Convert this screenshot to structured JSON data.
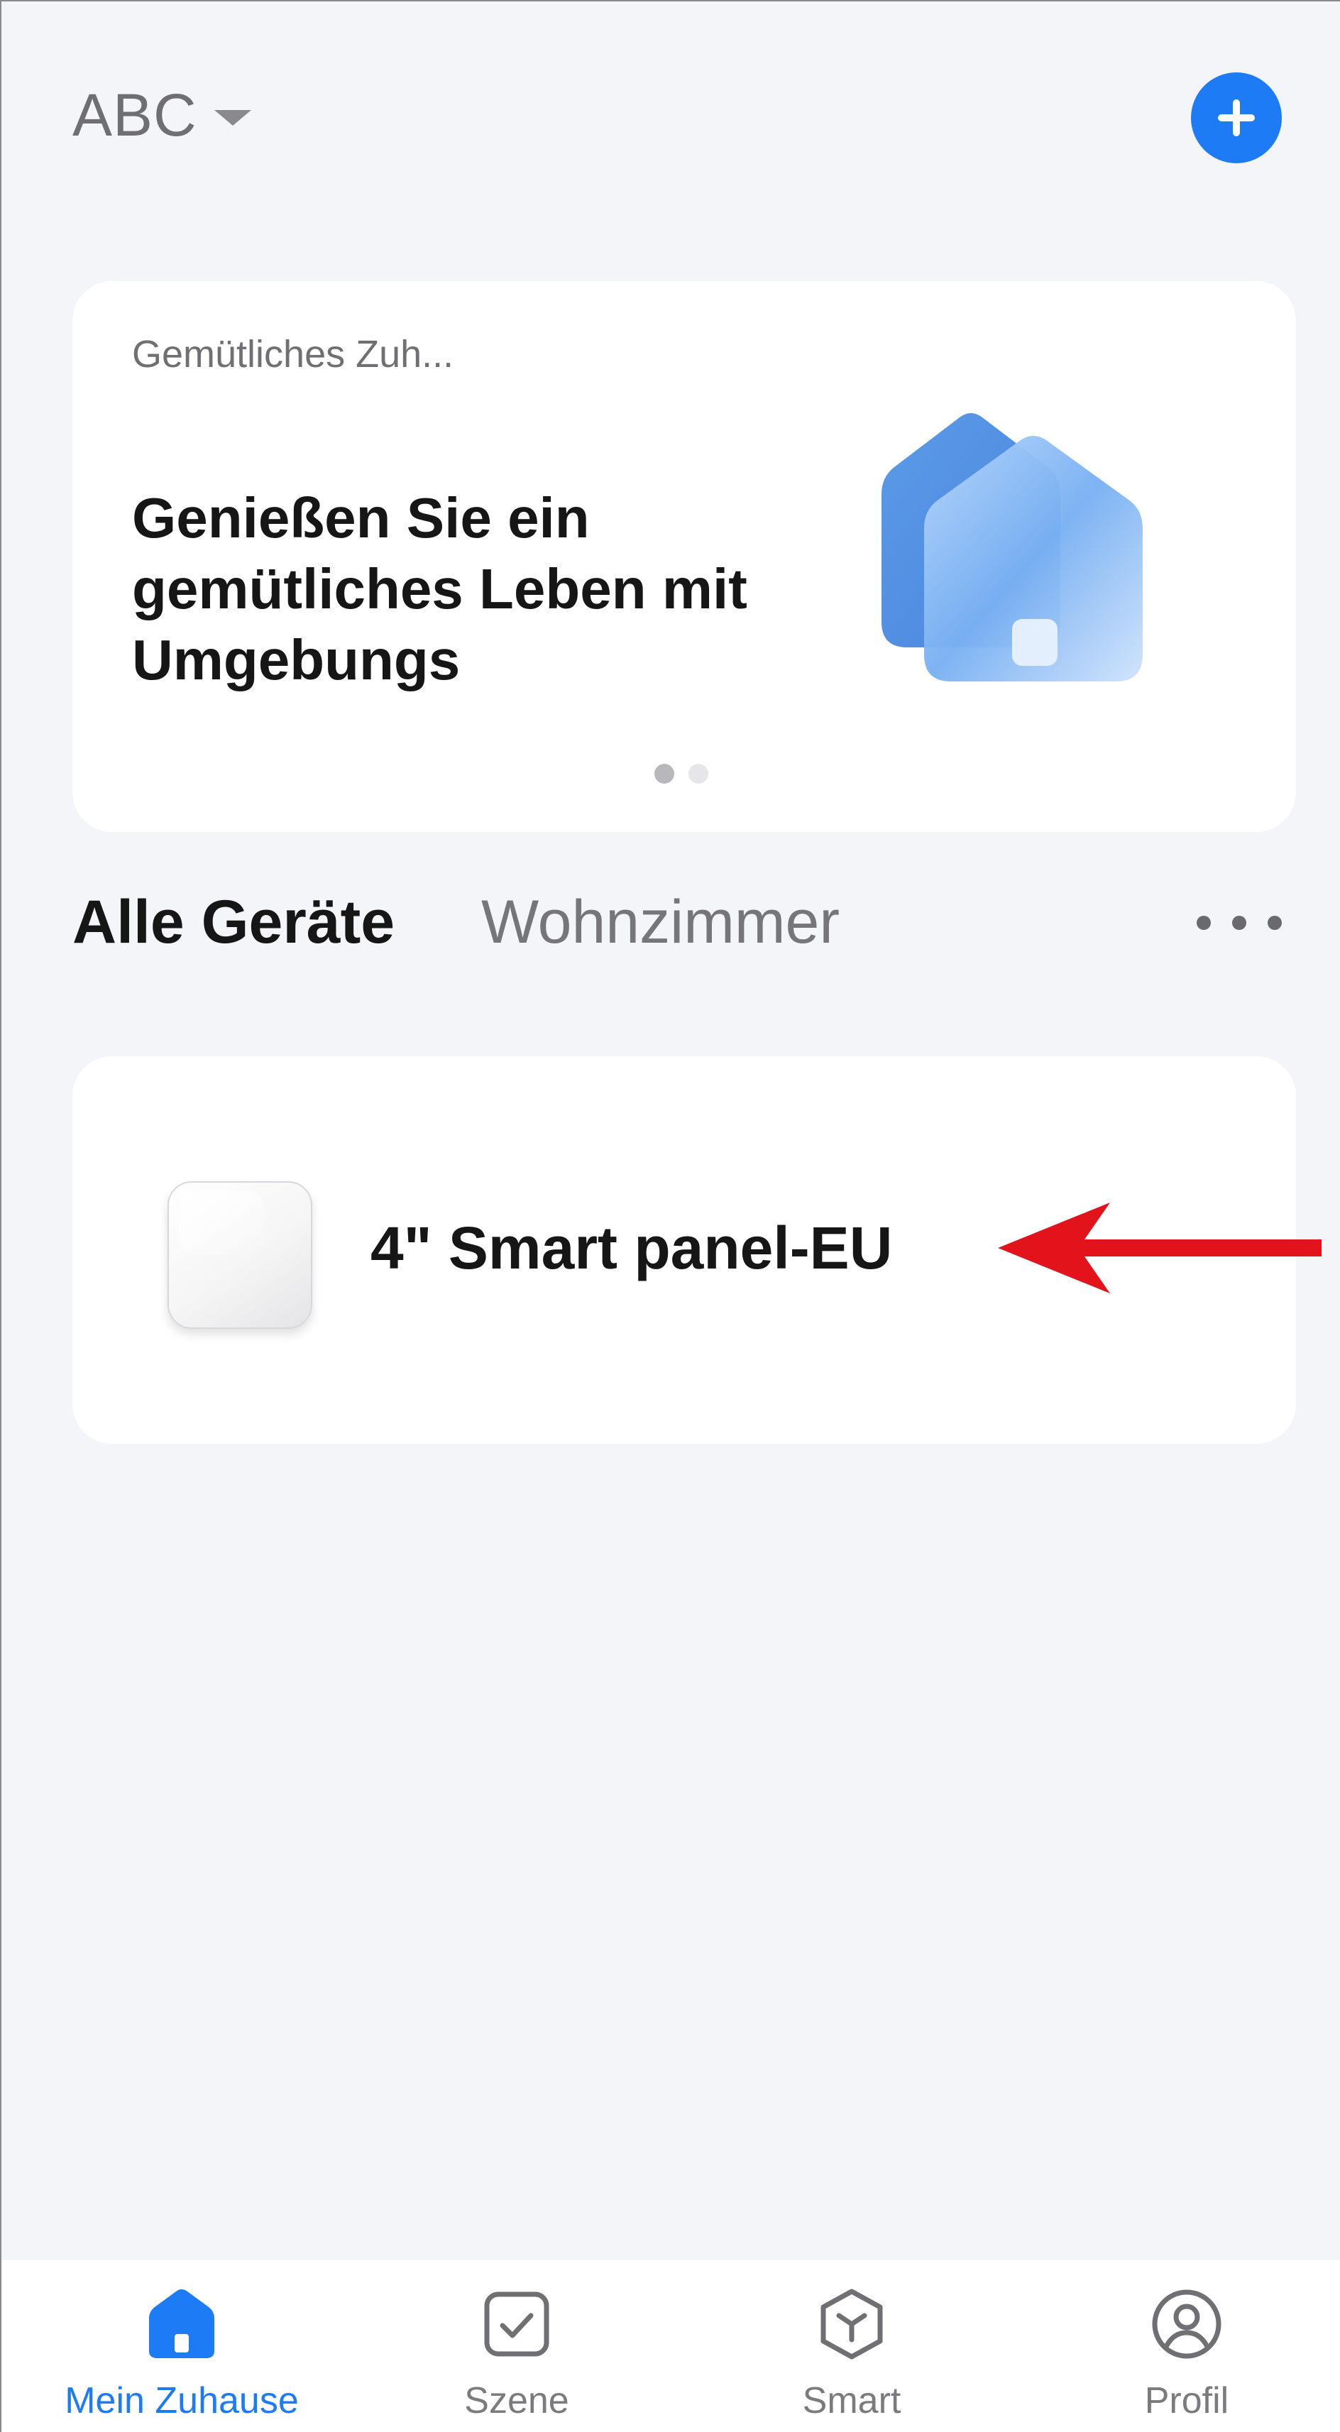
{
  "header": {
    "home_name": "ABC",
    "home_dropdown_icon": "caret-down-icon",
    "add_icon": "plus-icon",
    "accent_color": "#1c7bf5"
  },
  "banner": {
    "tag": "Gemütliches Zuh...",
    "headline": "Genießen Sie ein gemütliches Leben mit Umgebungs",
    "illustration_icon": "house-illustration-icon",
    "page_count": 2,
    "active_page": 1
  },
  "tabs": {
    "all_devices": "Alle Geräte",
    "room": "Wohnzimmer",
    "more_icon": "more-horizontal-icon"
  },
  "devices": [
    {
      "name": "4\" Smart panel-EU",
      "icon": "smart-panel-device-icon"
    }
  ],
  "annotation": {
    "arrow_color": "#e3131b",
    "icon": "red-arrow-left-icon"
  },
  "nav": {
    "items": [
      {
        "label": "Mein Zuhause",
        "icon": "home-icon",
        "active": true
      },
      {
        "label": "Szene",
        "icon": "checkbox-scene-icon",
        "active": false
      },
      {
        "label": "Smart",
        "icon": "smart-cube-icon",
        "active": false
      },
      {
        "label": "Profil",
        "icon": "profile-icon",
        "active": false
      }
    ]
  }
}
